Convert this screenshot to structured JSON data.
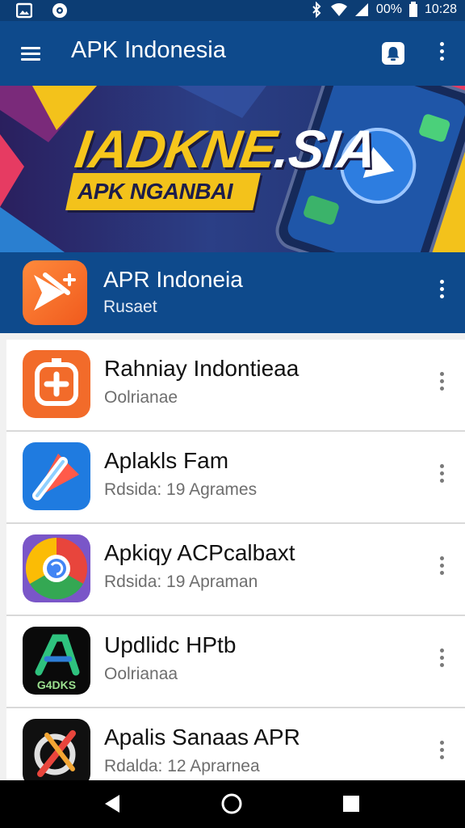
{
  "status_bar": {
    "battery_text": "00%",
    "time": "10:28",
    "icons": [
      "gallery-icon",
      "app-notification-icon",
      "bluetooth-icon",
      "wifi-icon",
      "signal-icon",
      "battery-icon"
    ]
  },
  "app_bar": {
    "title": "APK Indonesia",
    "icons": [
      "menu-icon",
      "notification-bell-icon",
      "more-vert-icon"
    ]
  },
  "banner": {
    "headline_yellow": "IADKNE",
    "headline_white": ".SIA",
    "tagline": "APK NGANBAI"
  },
  "featured": {
    "title": "APR Indoneia",
    "subtitle": "Rusaet"
  },
  "apps": [
    {
      "title": "Rahniay Indontieaa",
      "subtitle": "Oolrianae",
      "icon": "orange-plus-app-icon"
    },
    {
      "title": "Aplakls Fam",
      "subtitle": "Rdsida: 19 Agrames",
      "icon": "blue-pen-app-icon"
    },
    {
      "title": "Apkiqy ACPcalbaxt",
      "subtitle": "Rdsida: 19 Apraman",
      "icon": "chrome-swirl-app-icon"
    },
    {
      "title": "Updlidc HPtb",
      "subtitle": "Oolrianaa",
      "icon": "black-gadks-app-icon",
      "icon_label": "G4DKS"
    },
    {
      "title": "Apalis Sanaas APR",
      "subtitle": "Rdalda: 12 Aprarnea",
      "icon": "black-tools-app-icon"
    }
  ],
  "colors": {
    "primary": "#0e4a8c",
    "status_bar": "#0c3d74",
    "banner_yellow": "#f3c21b",
    "nav_bar": "#000000"
  }
}
